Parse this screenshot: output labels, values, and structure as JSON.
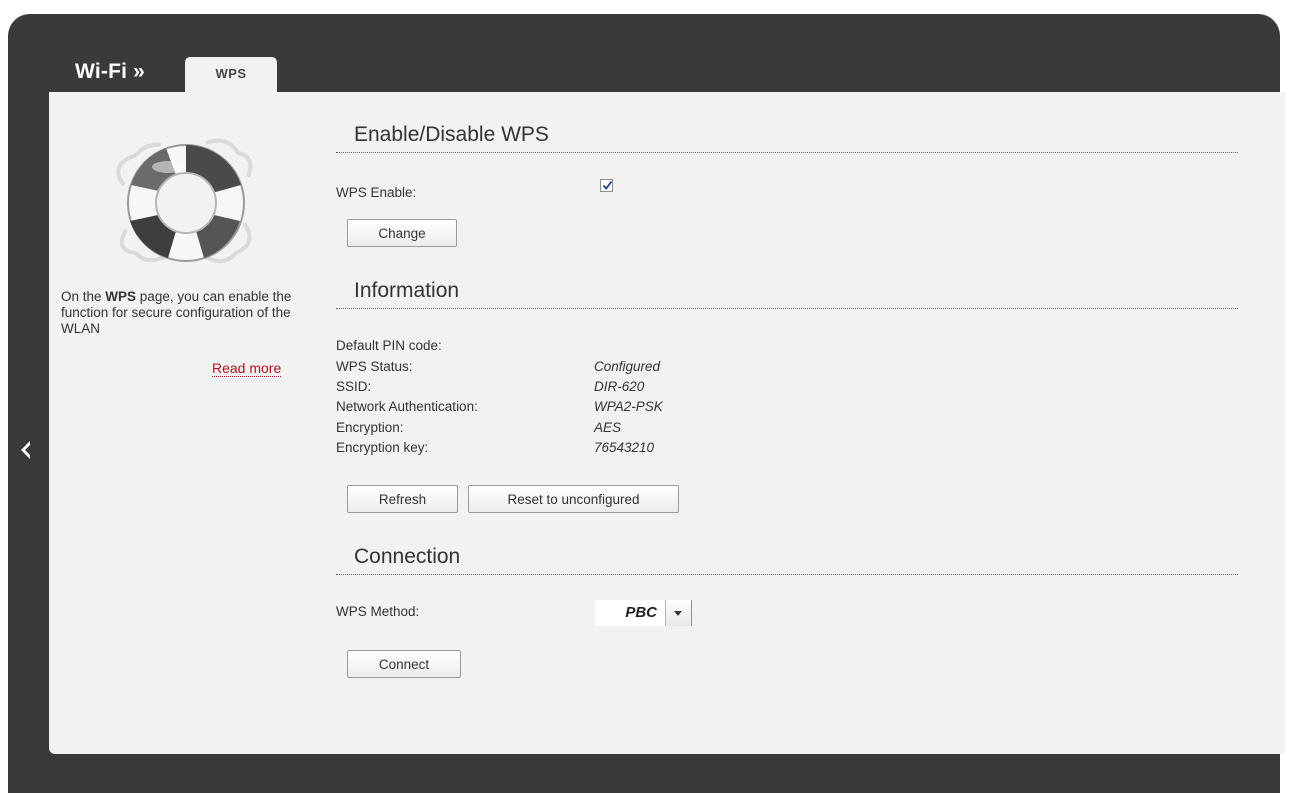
{
  "header": {
    "breadcrumb_root": "Wi-Fi »",
    "active_tab": "WPS"
  },
  "help": {
    "text_prefix": "On the ",
    "text_bold": "WPS",
    "text_suffix": " page, you can enable the function for secure configuration of the WLAN",
    "read_more": "Read more"
  },
  "enable_section": {
    "title": "Enable/Disable WPS",
    "wps_enable_label": "WPS Enable:",
    "wps_enabled": true,
    "change_button": "Change"
  },
  "information": {
    "title": "Information",
    "rows": [
      {
        "label": "Default PIN code:",
        "value": ""
      },
      {
        "label": "WPS Status:",
        "value": "Configured"
      },
      {
        "label": "SSID:",
        "value": "DIR-620"
      },
      {
        "label": "Network Authentication:",
        "value": "WPA2-PSK"
      },
      {
        "label": "Encryption:",
        "value": "AES"
      },
      {
        "label": "Encryption key:",
        "value": "76543210"
      }
    ],
    "refresh_button": "Refresh",
    "reset_button": "Reset to unconfigured"
  },
  "connection": {
    "title": "Connection",
    "method_label": "WPS Method:",
    "method_value": "PBC",
    "connect_button": "Connect"
  },
  "icons": {
    "help": "lifebuoy-icon",
    "nav": "chevron-left-icon"
  }
}
